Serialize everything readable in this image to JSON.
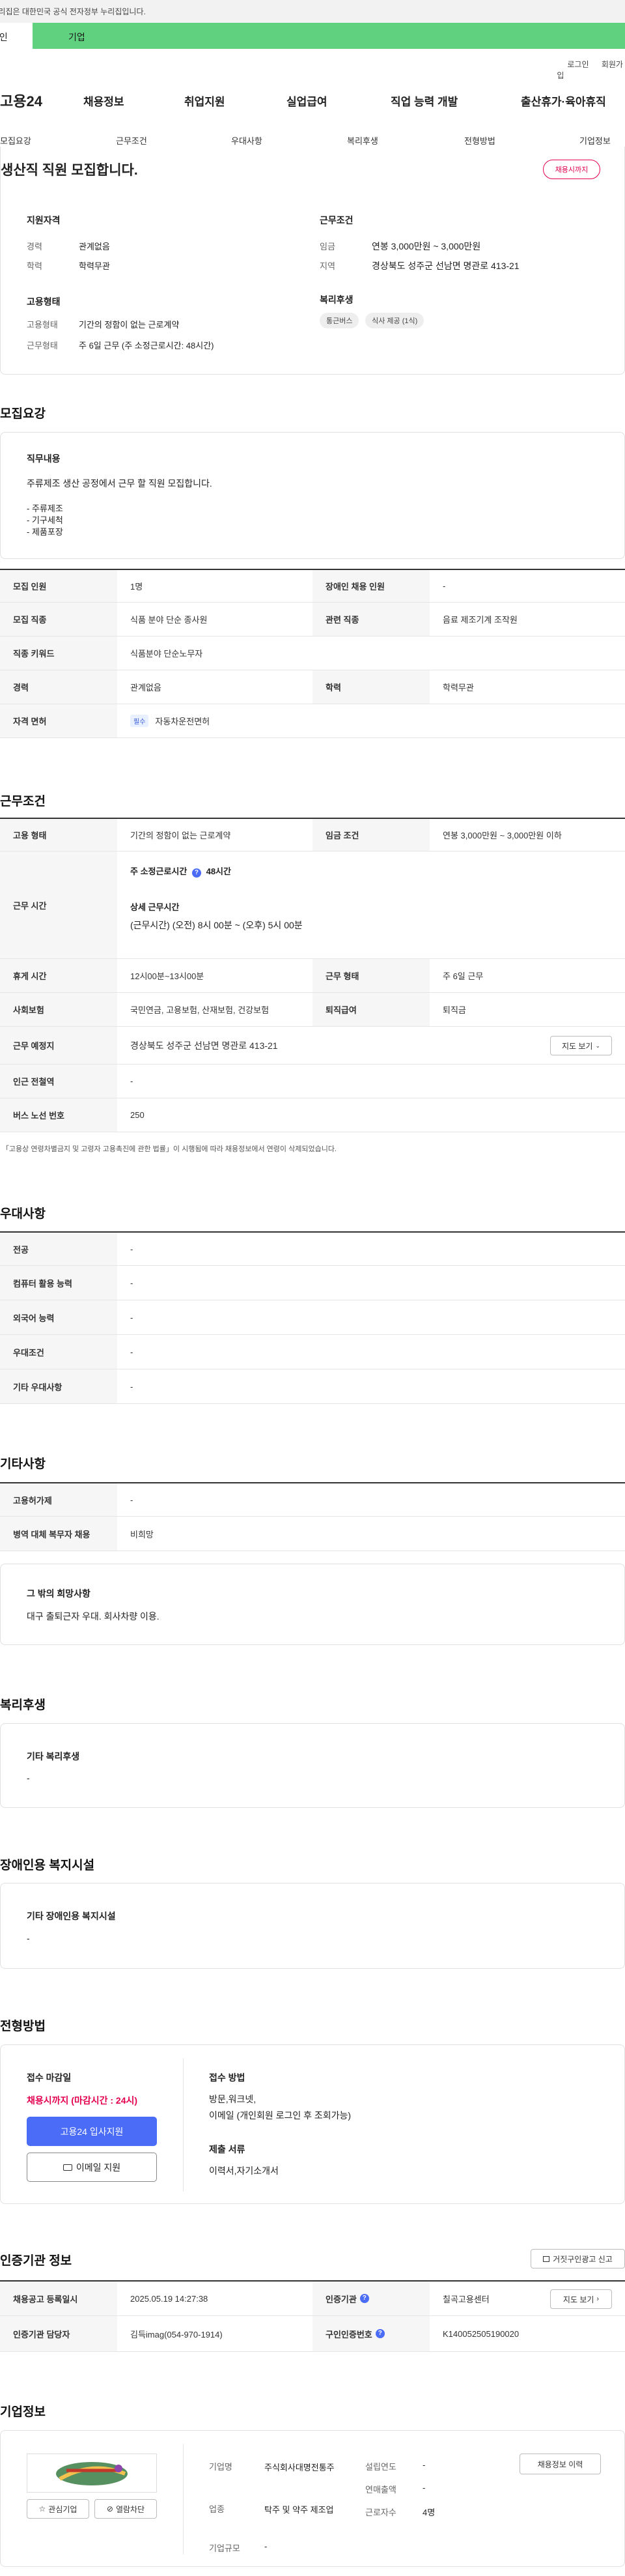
{
  "top": {
    "gov_notice": "이 누리집은 대한민국 공식 전자정부 누리집입니다.",
    "tab_individual": "개인",
    "tab_business": "기업",
    "login": "로그인",
    "signup": "회원가입"
  },
  "gnb": {
    "logo": "고용24",
    "menu": [
      "채용정보",
      "취업지원",
      "실업급여",
      "직업 능력 개발",
      "출산휴가·육아휴직"
    ]
  },
  "subnav": [
    "모집요강",
    "근무조건",
    "우대사항",
    "복리후생",
    "전형방법",
    "기업정보"
  ],
  "summary": {
    "title": "생산직 직원 모집합니다.",
    "status_badge": "채용시까지",
    "qual_title": "지원자격",
    "qual_rows": [
      [
        "경력",
        "관계없음"
      ],
      [
        "학력",
        "학력무관"
      ]
    ],
    "emp_title": "고용형태",
    "emp_rows": [
      [
        "고용형태",
        "기간의 정함이 없는 근로계약"
      ],
      [
        "근무형태",
        "주 6일 근무 (주 소정근로시간: 48시간)"
      ]
    ],
    "cond_title": "근무조건",
    "cond_rows": [
      [
        "임금",
        "연봉 3,000만원 ~ 3,000만원"
      ],
      [
        "지역",
        "경상북도 성주군 선남면 명관로 413-21"
      ]
    ],
    "welfare_title": "복리후생",
    "welfare_chips": [
      "통근버스",
      "식사 제공 (1식)"
    ]
  },
  "recruit": {
    "heading": "모집요강",
    "duty_title": "직무내용",
    "duty_text": "주류제조 생산 공정에서 근무 할 직원 모집합니다.",
    "duty_list": [
      "- 주류제조",
      "- 기구세척",
      "- 제품포장"
    ],
    "rows": {
      "headcount_label": "모집 인원",
      "headcount": "1명",
      "disabled_label": "장애인 채용 인원",
      "disabled": "-",
      "job_label": "모집 직종",
      "job": "식품 분야 단순 종사원",
      "related_label": "관련 직종",
      "related": "음료 제조기계 조작원",
      "keyword_label": "직종 키워드",
      "keyword": "식품분야 단순노무자",
      "career_label": "경력",
      "career": "관계없음",
      "edu_label": "학력",
      "edu": "학력무관",
      "license_label": "자격 면허",
      "license_badge": "필수",
      "license": "자동차운전면허"
    }
  },
  "work": {
    "heading": "근무조건",
    "emp_type_label": "고용 형태",
    "emp_type": "기간의 정함이 없는 근로계약",
    "wage_label": "임금 조건",
    "wage": "연봉 3,000만원 ~ 3,000만원 이하",
    "hours_label": "근무 시간",
    "weekly_label": "주 소정근로시간",
    "weekly": "48시간",
    "detail_label": "상세 근무시간",
    "detail": "(근무시간) (오전) 8시 00분 ~ (오후) 5시 00분",
    "rest_label": "휴게 시간",
    "rest": "12시00분~13시00분",
    "form_label": "근무 형태",
    "form": "주 6일 근무",
    "insurance_label": "사회보험",
    "insurance": "국민연금, 고용보험, 산재보험, 건강보험",
    "severance_label": "퇴직급여",
    "severance": "퇴직금",
    "place_label": "근무 예정지",
    "place": "경상북도 성주군 선남면 명관로 413-21",
    "map_btn": "지도 보기",
    "subway_label": "인근 전철역",
    "subway": "-",
    "bus_label": "버스 노선 번호",
    "bus": "250",
    "notice": "「고용상 연령차별금지 및 고령자 고용촉진에 관한 법률」이 시행됨에 따라 채용정보에서 연령이 삭제되었습니다."
  },
  "pref": {
    "heading": "우대사항",
    "rows": [
      [
        "전공",
        "-"
      ],
      [
        "컴퓨터 활용 능력",
        "-"
      ],
      [
        "외국어 능력",
        "-"
      ],
      [
        "우대조건",
        "-"
      ],
      [
        "기타 우대사항",
        "-"
      ]
    ]
  },
  "etc": {
    "heading": "기타사항",
    "rows": [
      [
        "고용허가제",
        "-"
      ],
      [
        "병역 대체 복무자 채용",
        "비희망"
      ]
    ],
    "box_title": "그 밖의 희망사항",
    "box_text": "대구 출퇴근자 우대. 회사차량 이용."
  },
  "welfare": {
    "heading": "복리후생",
    "box_title": "기타 복리후생",
    "box_text": "-"
  },
  "disab": {
    "heading": "장애인용 복지시설",
    "box_title": "기타 장애인용 복지시설",
    "box_text": "-"
  },
  "apply": {
    "heading": "전형방법",
    "deadline_label": "접수 마감일",
    "deadline": "채용시까지 (마감시간 : 24시)",
    "apply_btn": "고용24 입사지원",
    "email_btn": "이메일 지원",
    "method_label": "접수 방법",
    "method": "방문,워크넷,",
    "method2": "이메일 (개인회원 로그인 후 조회가능)",
    "docs_label": "제출 서류",
    "docs": "이력서,자기소개서"
  },
  "auth": {
    "heading": "인증기관 정보",
    "report_btn": "거짓구인광고 신고",
    "reg_date_label": "채용공고 등록일시",
    "reg_date": "2025.05.19 14:27:38",
    "agency_label": "인증기관",
    "agency": "칠곡고용센터",
    "agency_map_btn": "지도 보기",
    "manager_label": "인증기관 담당자",
    "manager": "김득imag(054-970-1914)",
    "code_label": "구인인증번호",
    "code": "K140052505190020"
  },
  "company": {
    "heading": "기업정보",
    "fav_btn": "관심기업",
    "block_btn": "열람차단",
    "name_label": "기업명",
    "name": "주식회사대명전통주",
    "industry_label": "업종",
    "industry": "탁주 및 약주 제조업",
    "size_label": "기업규모",
    "size": "-",
    "year_label": "설립연도",
    "year": "-",
    "sales_label": "연매출액",
    "sales": "-",
    "employees_label": "근로자수",
    "employees": "4명",
    "history_btn": "채용정보 이력"
  },
  "colors": {
    "brand_green": "#5fd17f",
    "accent_red": "#e4004f",
    "primary_blue": "#4a6cf7"
  }
}
